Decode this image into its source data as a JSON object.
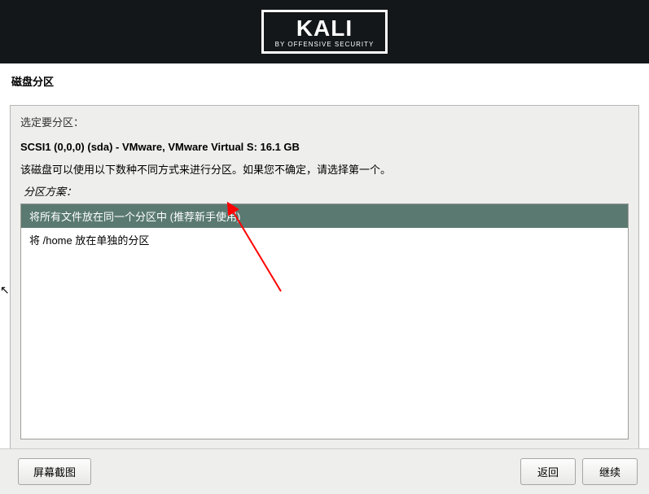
{
  "header": {
    "logo_main": "KALI",
    "logo_sub": "BY OFFENSIVE SECURITY"
  },
  "page": {
    "title": "磁盘分区",
    "select_partition_label": "选定要分区：",
    "disk_info": "SCSI1 (0,0,0) (sda) - VMware, VMware Virtual S: 16.1 GB",
    "helper_text": "该磁盘可以使用以下数种不同方式来进行分区。如果您不确定，请选择第一个。",
    "scheme_label": "分区方案：",
    "options": [
      {
        "label": "将所有文件放在同一个分区中 (推荐新手使用)",
        "selected": true
      },
      {
        "label": "将 /home 放在单独的分区",
        "selected": false
      }
    ]
  },
  "footer": {
    "screenshot_label": "屏幕截图",
    "back_label": "返回",
    "continue_label": "继续"
  }
}
